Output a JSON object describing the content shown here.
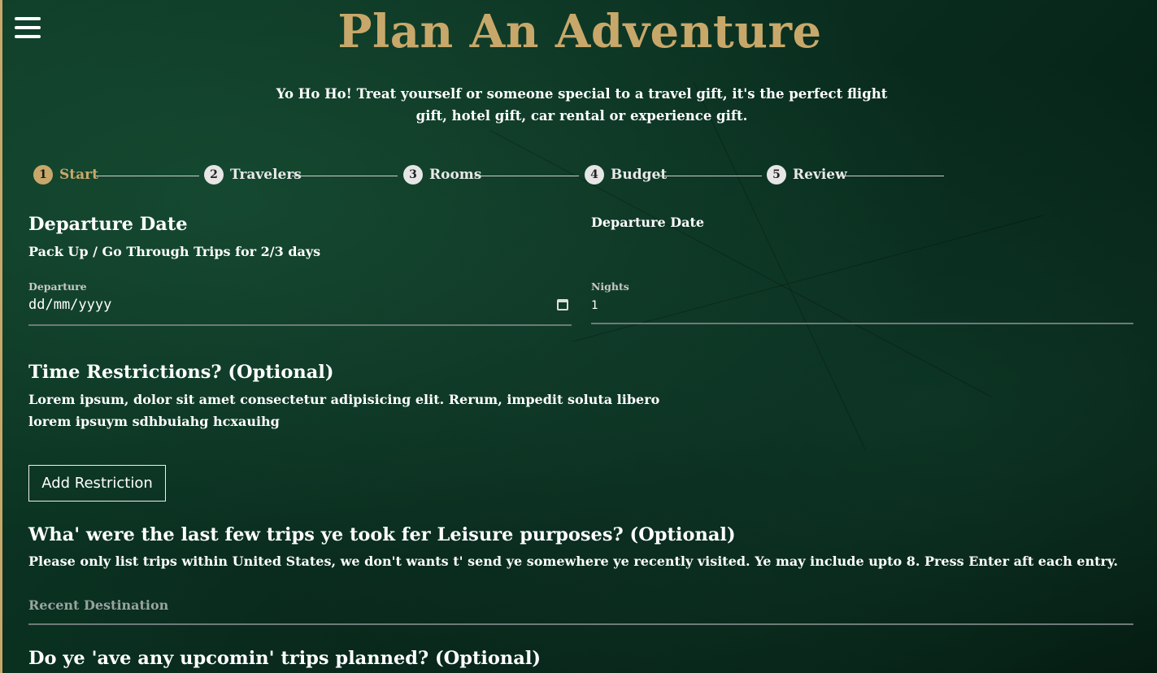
{
  "header": {
    "title": "Plan An Adventure",
    "subtitle": "Yo Ho Ho! Treat yourself or someone special to a travel gift, it's the perfect flight gift, hotel gift, car rental or experience gift."
  },
  "stepper": {
    "steps": [
      {
        "num": "1",
        "label": "Start"
      },
      {
        "num": "2",
        "label": "Travelers"
      },
      {
        "num": "3",
        "label": "Rooms"
      },
      {
        "num": "4",
        "label": "Budget"
      },
      {
        "num": "5",
        "label": "Review"
      }
    ],
    "active_step": 1
  },
  "departure": {
    "heading": "Departure Date",
    "description": "Pack Up / Go Through Trips for 2/3 days",
    "right_heading": "Departure Date",
    "departure_label": "Departure",
    "departure_value": "dd/mm/yyyy",
    "nights_label": "Nights",
    "nights_value": "1"
  },
  "restrictions": {
    "heading": "Time Restrictions? (Optional)",
    "description_line1": "Lorem ipsum, dolor sit amet consectetur adipisicing elit. Rerum, impedit soluta libero",
    "description_line2": "lorem ipsuym sdhbuiahg hcxauihg",
    "add_button": "Add Restriction"
  },
  "recent_trips": {
    "heading": "Wha' were the last few trips ye took fer Leisure purposes? (Optional)",
    "description": "Please only list trips within United States, we don't wants t' send ye somewhere ye recently visited. Ye may include upto 8. Press Enter aft each entry.",
    "placeholder": "Recent Destination"
  },
  "upcoming_trips": {
    "heading": "Do ye 'ave any upcomin' trips planned? (Optional)"
  },
  "colors": {
    "accent": "#c8a86a",
    "background": "#0a2f20"
  },
  "icons": {
    "menu": "hamburger-menu-icon",
    "calendar": "calendar-icon"
  }
}
